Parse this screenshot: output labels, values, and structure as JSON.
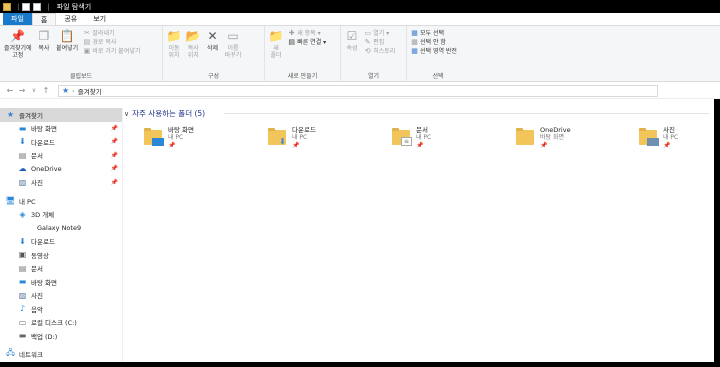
{
  "window": {
    "title": "파일 탐색기",
    "quick_access_icons": [
      "folder-icon",
      "document-icon",
      "document-icon"
    ]
  },
  "tabs": [
    {
      "label": "파일"
    },
    {
      "label": "홈"
    },
    {
      "label": "공유"
    },
    {
      "label": "보기"
    }
  ],
  "ribbon": {
    "clipboard": {
      "label": "클립보드",
      "pin": "즐겨찾기에\n고정",
      "copy": "복사",
      "paste": "붙여넣기",
      "cut": "잘라내기",
      "copy_path": "경로 복사",
      "paste_shortcut": "바로 가기 붙여넣기"
    },
    "organize": {
      "label": "구성",
      "move_to": "이동\n위치",
      "copy_to": "복사\n위치",
      "delete": "삭제",
      "rename": "이름\n바꾸기"
    },
    "new": {
      "label": "새로 만들기",
      "new_folder": "새\n폴더",
      "new_item": "새 항목",
      "easy_access": "빠른 연결"
    },
    "open": {
      "label": "열기",
      "properties": "속성",
      "open": "열기",
      "edit": "편집",
      "history": "히스토리"
    },
    "select": {
      "label": "선택",
      "select_all": "모두 선택",
      "select_none": "선택 안 함",
      "invert": "선택 영역 반전"
    }
  },
  "address": {
    "path": "즐겨찾기"
  },
  "navpane": {
    "quick_access": {
      "label": "즐겨찾기",
      "items": [
        {
          "label": "바탕 화면",
          "icon": "desktop-icon"
        },
        {
          "label": "다운로드",
          "icon": "download-icon"
        },
        {
          "label": "문서",
          "icon": "document-icon"
        },
        {
          "label": "OneDrive",
          "icon": "cloud-icon"
        },
        {
          "label": "사진",
          "icon": "pictures-icon"
        }
      ]
    },
    "this_pc": {
      "label": "내 PC",
      "items": [
        {
          "label": "3D 개체",
          "icon": "3d-objects-icon"
        },
        {
          "label": "Galaxy Note9",
          "icon": "phone-icon"
        },
        {
          "label": "다운로드",
          "icon": "download-icon"
        },
        {
          "label": "동영상",
          "icon": "video-icon"
        },
        {
          "label": "문서",
          "icon": "document-icon"
        },
        {
          "label": "바탕 화면",
          "icon": "desktop-icon"
        },
        {
          "label": "사진",
          "icon": "pictures-icon"
        },
        {
          "label": "음악",
          "icon": "music-icon"
        },
        {
          "label": "로컬 디스크 (C:)",
          "icon": "disk-icon"
        },
        {
          "label": "백업 (D:)",
          "icon": "drive-icon"
        }
      ]
    },
    "network": {
      "label": "네트워크"
    }
  },
  "content": {
    "section_title": "자주 사용하는 폴더 (5)",
    "folders": [
      {
        "name": "바탕 화면",
        "location": "내 PC",
        "overlay": "desktop-icon"
      },
      {
        "name": "다운로드",
        "location": "내 PC",
        "overlay": "download-icon"
      },
      {
        "name": "문서",
        "location": "내 PC",
        "overlay": "document-icon"
      },
      {
        "name": "OneDrive",
        "location": "바탕 화면",
        "overlay": "none"
      },
      {
        "name": "사진",
        "location": "내 PC",
        "overlay": "pictures-icon"
      }
    ]
  },
  "colors": {
    "accent": "#1979ca",
    "folder": "#f1c55a",
    "section_header": "#1e3287",
    "selected_nav": "#d9d9d9"
  }
}
